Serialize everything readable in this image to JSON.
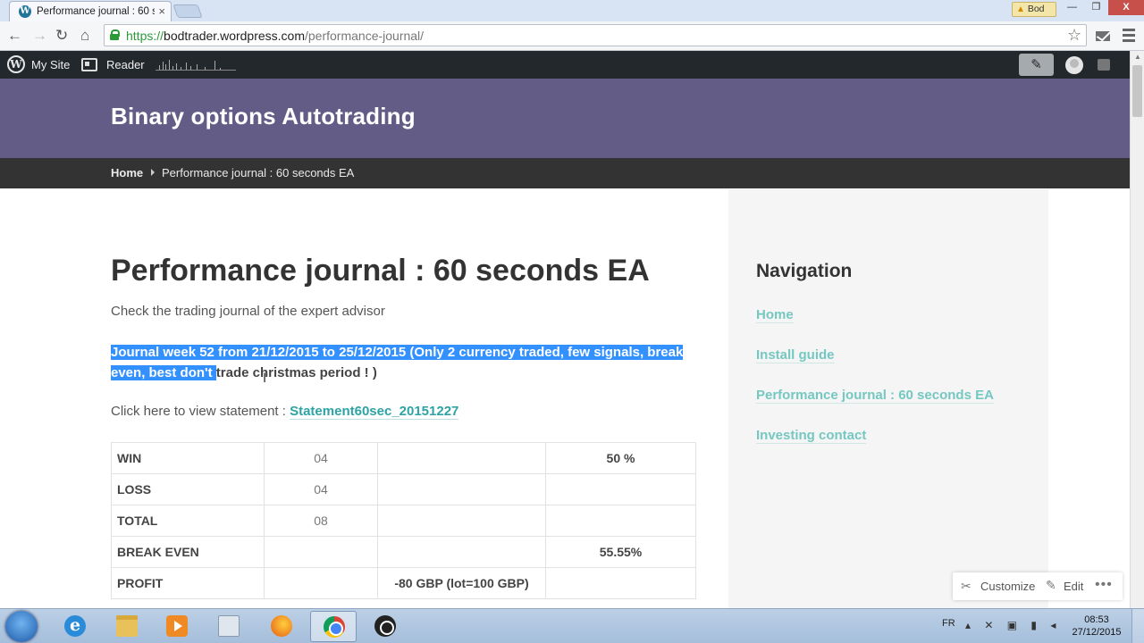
{
  "browser": {
    "tab_title": "Performance journal : 60 s",
    "tab_close": "×",
    "profile_name": "Bod",
    "url_scheme": "https://",
    "url_host": "bodtrader.wordpress.com",
    "url_path": "/performance-journal/",
    "window_controls": {
      "minimize": "—",
      "maximize": "❐",
      "close": "X"
    }
  },
  "admin_bar": {
    "my_site": "My Site",
    "reader": "Reader"
  },
  "site": {
    "title": "Binary options Autotrading",
    "accent_color": "#625c87"
  },
  "breadcrumb": {
    "home": "Home",
    "current": "Performance journal : 60 seconds EA"
  },
  "post": {
    "title": "Performance journal : 60 seconds EA",
    "intro": "Check the trading journal of the expert advisor",
    "journal_selected": "Journal week 52 from 21/12/2015 to 25/12/2015 (Only 2 currency traded, few signals, break even, best don't ",
    "journal_rest": "trade christmas period ! )",
    "statement_prefix": "Click here to view statement : ",
    "statement_link": "Statement60sec_20151227"
  },
  "stats_table": {
    "rows": [
      {
        "label": "WIN",
        "count": "04",
        "amount": "",
        "percent": "50 %"
      },
      {
        "label": "LOSS",
        "count": "04",
        "amount": "",
        "percent": ""
      },
      {
        "label": "TOTAL",
        "count": "08",
        "amount": "",
        "percent": ""
      },
      {
        "label": "BREAK EVEN",
        "count": "",
        "amount": "",
        "percent": "55.55%"
      },
      {
        "label": "PROFIT",
        "count": "",
        "amount": "-80 GBP (lot=100 GBP)",
        "percent": ""
      }
    ]
  },
  "sidebar": {
    "title": "Navigation",
    "links": [
      "Home",
      "Install guide",
      "Performance journal : 60 seconds EA",
      "Investing contact"
    ],
    "link_color": "#75c7c1"
  },
  "customize_bar": {
    "customize": "Customize",
    "edit": "Edit"
  },
  "taskbar": {
    "language": "FR",
    "time": "08:53",
    "date": "27/12/2015"
  }
}
